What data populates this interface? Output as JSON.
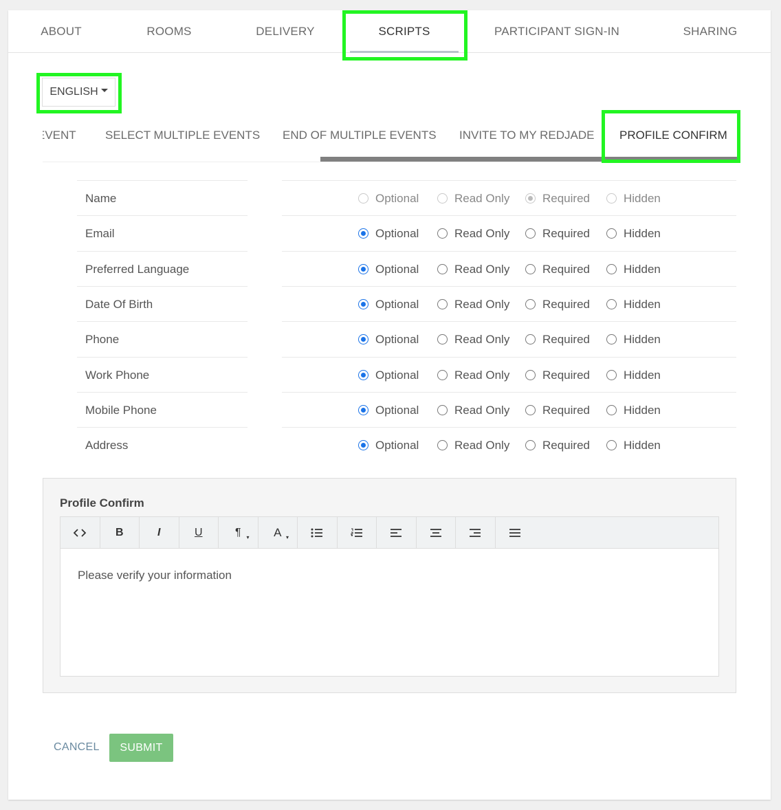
{
  "top_tabs": [
    {
      "label": "ABOUT"
    },
    {
      "label": "ROOMS"
    },
    {
      "label": "DELIVERY"
    },
    {
      "label": "SCRIPTS"
    },
    {
      "label": "PARTICIPANT SIGN-IN"
    },
    {
      "label": "SHARING"
    }
  ],
  "language": {
    "selected": "ENGLISH"
  },
  "script_tabs": [
    {
      "label": "EVENT"
    },
    {
      "label": "SELECT MULTIPLE EVENTS"
    },
    {
      "label": "END OF MULTIPLE EVENTS"
    },
    {
      "label": "INVITE TO MY REDJADE"
    },
    {
      "label": "PROFILE CONFIRM"
    }
  ],
  "option_labels": [
    "Optional",
    "Read Only",
    "Required",
    "Hidden"
  ],
  "fields": [
    {
      "label": "Name",
      "selected": "Required",
      "disabled": true
    },
    {
      "label": "Email",
      "selected": "Optional",
      "disabled": false
    },
    {
      "label": "Preferred Language",
      "selected": "Optional",
      "disabled": false
    },
    {
      "label": "Date Of Birth",
      "selected": "Optional",
      "disabled": false
    },
    {
      "label": "Phone",
      "selected": "Optional",
      "disabled": false
    },
    {
      "label": "Work Phone",
      "selected": "Optional",
      "disabled": false
    },
    {
      "label": "Mobile Phone",
      "selected": "Optional",
      "disabled": false
    },
    {
      "label": "Address",
      "selected": "Optional",
      "disabled": false
    }
  ],
  "editor": {
    "title": "Profile Confirm",
    "content": "Please verify your information",
    "toolbar": [
      {
        "icon": "code-view-icon",
        "glyph": "<>"
      },
      {
        "icon": "bold-icon",
        "glyph": "B"
      },
      {
        "icon": "italic-icon",
        "glyph": "I"
      },
      {
        "icon": "underline-icon",
        "glyph": "U"
      },
      {
        "icon": "paragraph-style-icon",
        "glyph": "¶"
      },
      {
        "icon": "font-color-icon",
        "glyph": "A"
      },
      {
        "icon": "unordered-list-icon",
        "glyph": ""
      },
      {
        "icon": "ordered-list-icon",
        "glyph": ""
      },
      {
        "icon": "align-left-icon",
        "glyph": ""
      },
      {
        "icon": "align-center-icon",
        "glyph": ""
      },
      {
        "icon": "align-right-icon",
        "glyph": ""
      },
      {
        "icon": "justify-icon",
        "glyph": ""
      }
    ]
  },
  "actions": {
    "cancel": "CANCEL",
    "submit": "SUBMIT"
  },
  "colors": {
    "highlight": "#22f522",
    "accent": "#1a73e8",
    "submit": "#7bc47f"
  }
}
